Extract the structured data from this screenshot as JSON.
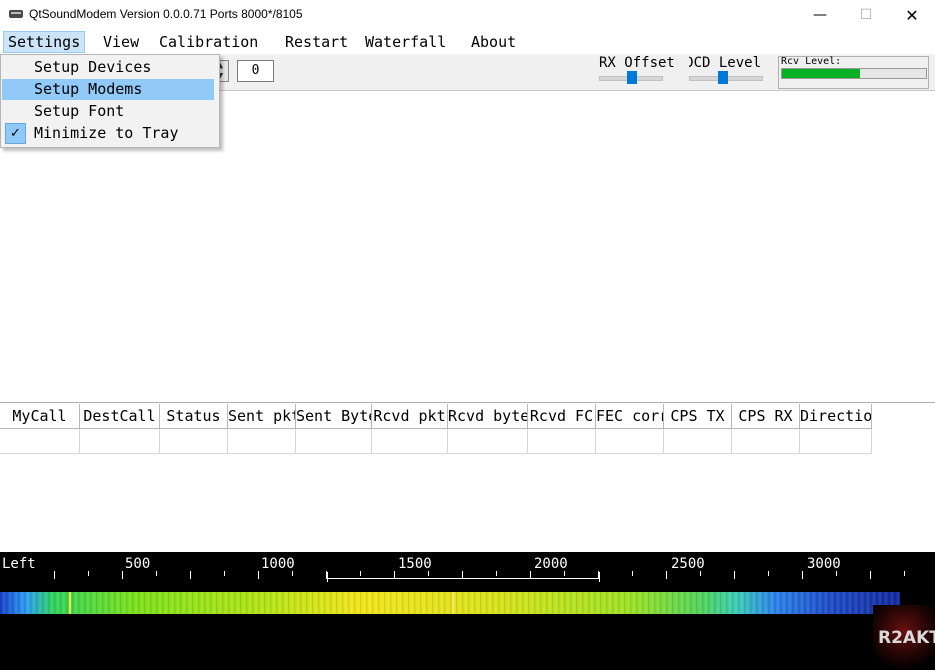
{
  "window": {
    "title": "QtSoundModem Version 0.0.0.71 Ports 8000*/8105",
    "minimize_glyph": "—",
    "maximize_glyph": "☐",
    "close_glyph": "✕"
  },
  "menubar": {
    "settings": "Settings",
    "view": "View",
    "calibration": "Calibration",
    "restart": "Restart",
    "waterfall": "Waterfall",
    "about": "About"
  },
  "settings_menu": {
    "items": [
      "Setup Devices",
      "Setup Modems",
      "Setup Font",
      "Minimize to Tray"
    ],
    "highlighted": "Setup Modems",
    "checked": "Minimize to Tray",
    "check_glyph": "✓"
  },
  "toolbar": {
    "spin_value": "0",
    "rx_offset_label": "RX Offset",
    "dcd_label": "DCD Level",
    "rx_offset_position": 0.45,
    "dcd_position": 0.4,
    "rcv_level_label": "Rcv Level:",
    "rcv_level_fraction": 0.54
  },
  "table": {
    "headers": [
      "MyCall",
      "DestCall",
      "Status",
      "Sent pkt",
      "Sent Bytes",
      "Rcvd pkt",
      "Rcvd bytes",
      "Rcvd FC",
      "FEC corr",
      "CPS TX",
      "CPS RX",
      "Direction"
    ]
  },
  "waterfall": {
    "left_label": "Left",
    "scale_labels": [
      "500",
      "1000",
      "1500",
      "2000",
      "2500",
      "3000"
    ],
    "logo_text": "R2AKT"
  },
  "colors": {
    "menu_highlight": "#91c9f7",
    "slider_thumb": "#0078d7",
    "rcv_bar": "#06b025"
  }
}
